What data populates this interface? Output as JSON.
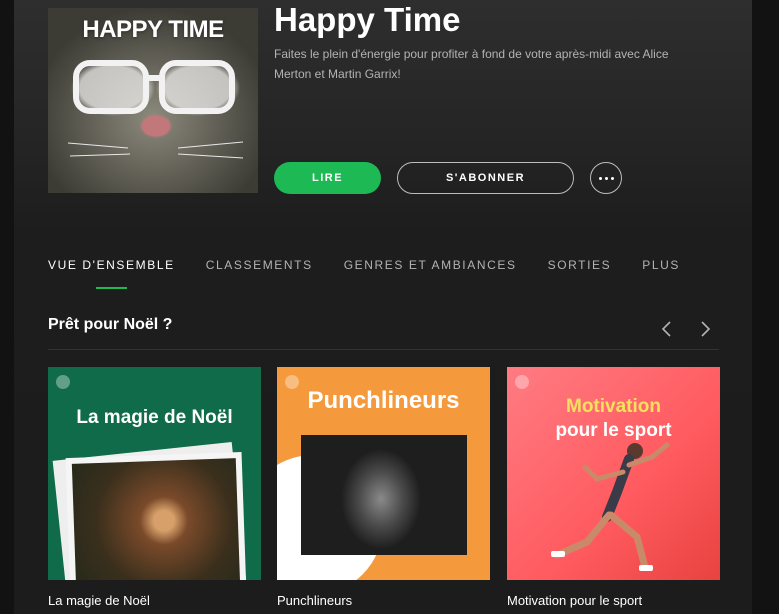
{
  "playlist": {
    "cover_text": "HAPPY TIME",
    "title": "Happy Time",
    "description": "Faites le plein d'énergie pour profiter à fond de votre après-midi avec Alice Merton et Martin Garrix!"
  },
  "actions": {
    "play_label": "LIRE",
    "follow_label": "S'ABONNER",
    "more_icon": "ellipsis-icon"
  },
  "tabs": [
    {
      "label": "VUE D'ENSEMBLE",
      "active": true
    },
    {
      "label": "CLASSEMENTS",
      "active": false
    },
    {
      "label": "GENRES ET AMBIANCES",
      "active": false
    },
    {
      "label": "SORTIES",
      "active": false
    },
    {
      "label": "PLUS",
      "active": false
    }
  ],
  "section": {
    "title": "Prêt pour Noël ?",
    "prev_icon": "chevron-left-icon",
    "next_icon": "chevron-right-icon"
  },
  "cards": [
    {
      "art_title": "La magie de Noël",
      "name": "La magie de Noël"
    },
    {
      "art_title": "Punchlineurs",
      "name": "Punchlineurs"
    },
    {
      "art_title_line1": "Motivation",
      "art_title_line2": "pour le sport",
      "name": "Motivation pour le sport"
    }
  ],
  "colors": {
    "accent": "#1db954",
    "background": "#1c1c1c",
    "text_secondary": "#b3b3b3"
  }
}
